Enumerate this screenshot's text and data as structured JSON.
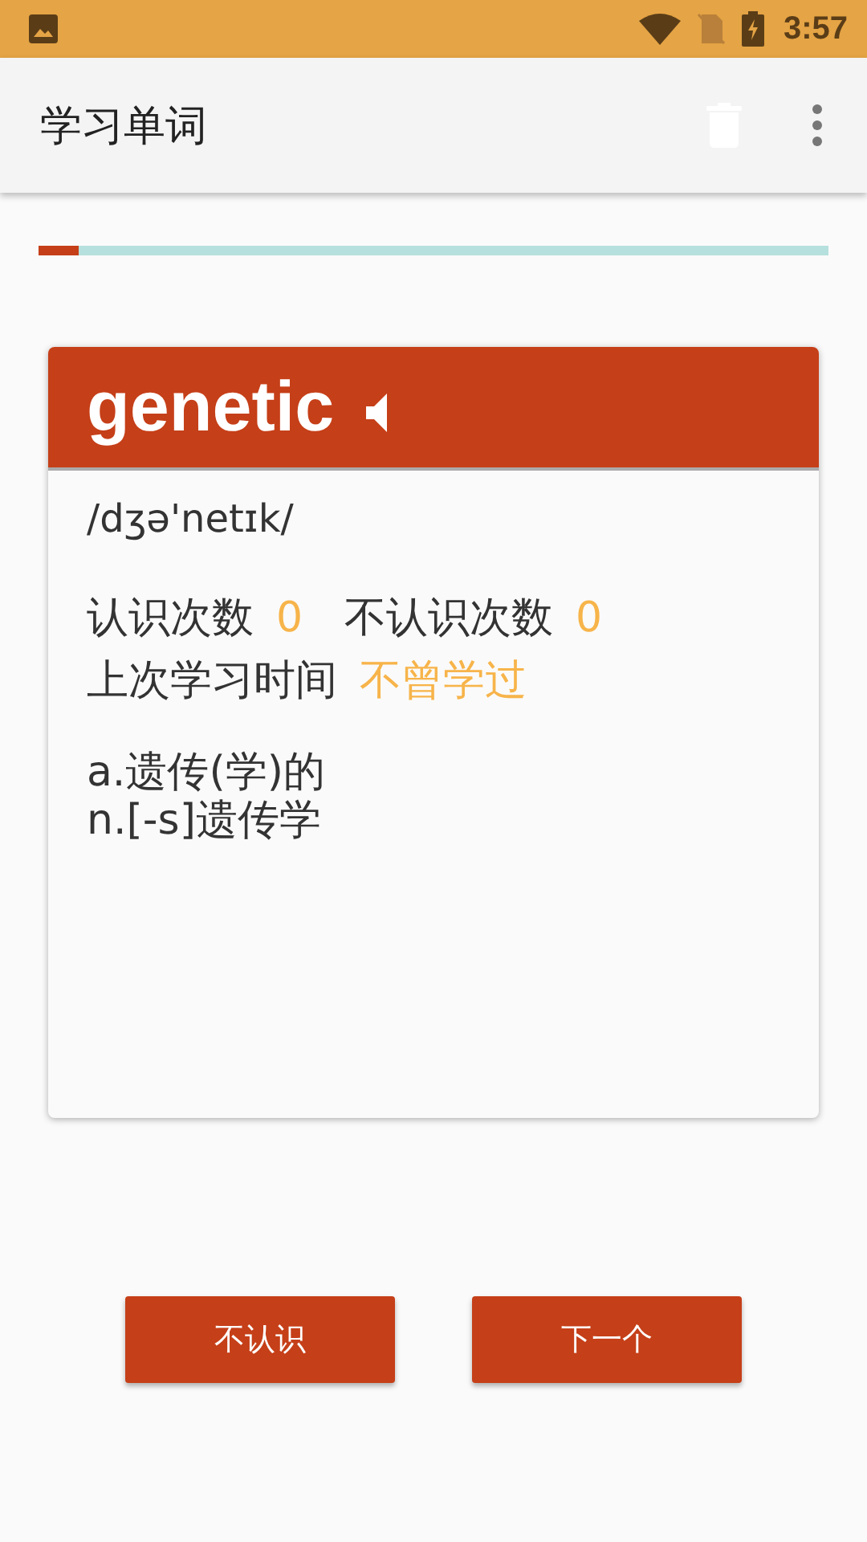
{
  "status_bar": {
    "time": "3:57"
  },
  "app_bar": {
    "title": "学习单词"
  },
  "progress": {
    "level": 0.05
  },
  "card": {
    "word": "genetic",
    "phonetic": "/dʒə'netɪk/",
    "stats": [
      {
        "label": "认识次数",
        "value": "0"
      },
      {
        "label": "不认识次数",
        "value": "0"
      }
    ],
    "last_study": {
      "label": "上次学习时间",
      "value": "不曾学过"
    },
    "definitions": [
      "a.遗传(学)的",
      "n.[-s]遗传学"
    ]
  },
  "buttons": [
    "不认识",
    "下一个"
  ]
}
